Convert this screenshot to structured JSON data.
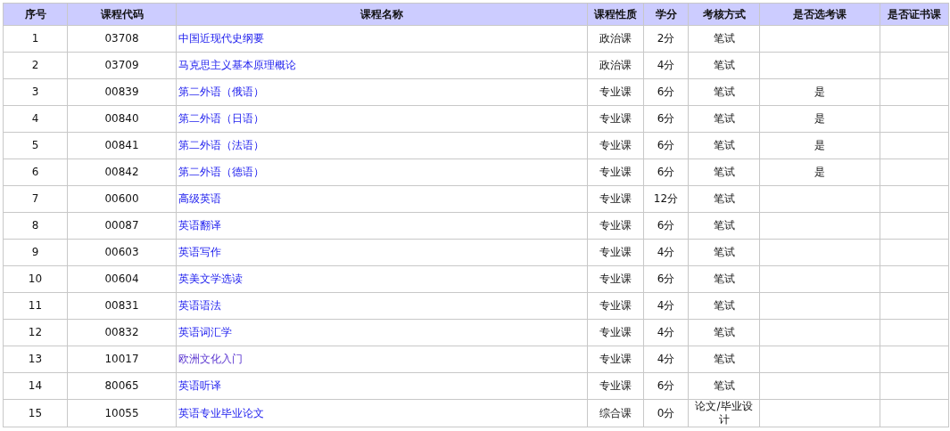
{
  "table": {
    "columns": [
      "序号",
      "课程代码",
      "课程名称",
      "课程性质",
      "学分",
      "考核方式",
      "是否选考课",
      "是否证书课"
    ],
    "rows": [
      {
        "no": "1",
        "code": "03708",
        "name": "中国近现代史纲要",
        "visited": false,
        "type": "政治课",
        "credits": "2分",
        "exam": "笔试"
      },
      {
        "no": "2",
        "code": "03709",
        "name": "马克思主义基本原理概论",
        "visited": false,
        "type": "政治课",
        "credits": "4分",
        "exam": "笔试"
      },
      {
        "no": "3",
        "code": "00839",
        "name": "第二外语（俄语）",
        "visited": false,
        "type": "专业课",
        "credits": "6分",
        "exam": "笔试",
        "elective": "是"
      },
      {
        "no": "4",
        "code": "00840",
        "name": "第二外语（日语）",
        "visited": false,
        "type": "专业课",
        "credits": "6分",
        "exam": "笔试",
        "elective": "是"
      },
      {
        "no": "5",
        "code": "00841",
        "name": "第二外语（法语）",
        "visited": false,
        "type": "专业课",
        "credits": "6分",
        "exam": "笔试",
        "elective": "是"
      },
      {
        "no": "6",
        "code": "00842",
        "name": "第二外语（德语）",
        "visited": false,
        "type": "专业课",
        "credits": "6分",
        "exam": "笔试",
        "elective": "是"
      },
      {
        "no": "7",
        "code": "00600",
        "name": "高级英语",
        "visited": false,
        "type": "专业课",
        "credits": "12分",
        "exam": "笔试"
      },
      {
        "no": "8",
        "code": "00087",
        "name": "英语翻译",
        "visited": false,
        "type": "专业课",
        "credits": "6分",
        "exam": "笔试"
      },
      {
        "no": "9",
        "code": "00603",
        "name": "英语写作",
        "visited": false,
        "type": "专业课",
        "credits": "4分",
        "exam": "笔试"
      },
      {
        "no": "10",
        "code": "00604",
        "name": "英美文学选读",
        "visited": false,
        "type": "专业课",
        "credits": "6分",
        "exam": "笔试"
      },
      {
        "no": "11",
        "code": "00831",
        "name": "英语语法",
        "visited": false,
        "type": "专业课",
        "credits": "4分",
        "exam": "笔试"
      },
      {
        "no": "12",
        "code": "00832",
        "name": "英语词汇学",
        "visited": false,
        "type": "专业课",
        "credits": "4分",
        "exam": "笔试"
      },
      {
        "no": "13",
        "code": "10017",
        "name": "欧洲文化入门",
        "visited": true,
        "type": "专业课",
        "credits": "4分",
        "exam": "笔试"
      },
      {
        "no": "14",
        "code": "80065",
        "name": "英语听译",
        "visited": false,
        "type": "专业课",
        "credits": "6分",
        "exam": "笔试"
      },
      {
        "no": "15",
        "code": "10055",
        "name": "英语专业毕业论文",
        "visited": false,
        "type": "综合课",
        "credits": "0分",
        "exam": "论文/毕业设计"
      }
    ]
  }
}
